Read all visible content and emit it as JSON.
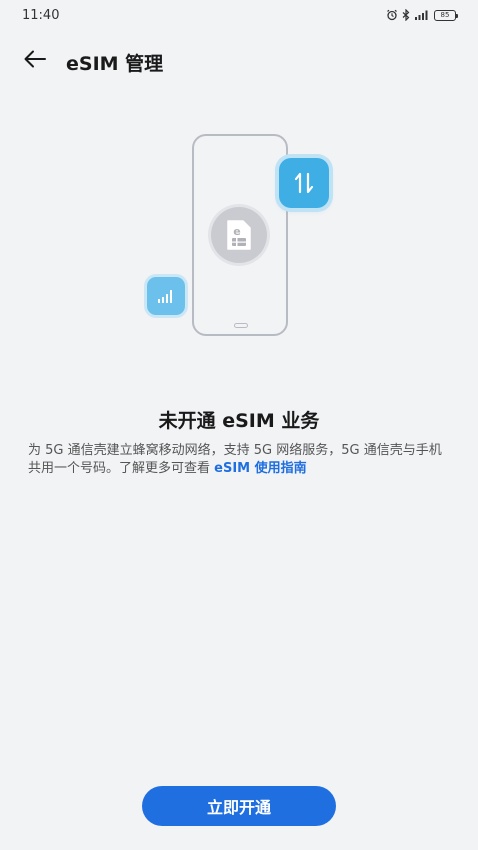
{
  "status_bar": {
    "time": "11:40",
    "battery_level": "85",
    "icons": [
      "alarm-icon",
      "bluetooth-icon",
      "signal-icon",
      "battery-icon"
    ]
  },
  "header": {
    "title": "eSIM 管理",
    "back_icon": "back-arrow-icon"
  },
  "illustration": {
    "sim_label": "e"
  },
  "content": {
    "headline": "未开通 eSIM 业务",
    "description": "为 5G 通信壳建立蜂窝移动网络，支持 5G 网络服务，5G 通信壳与手机共用一个号码。了解更多可查看 ",
    "guide_link": "eSIM 使用指南"
  },
  "actions": {
    "activate_label": "立即开通"
  },
  "colors": {
    "background": "#f1f3f5",
    "accent": "#1f6fe0",
    "bubble_blue": "#3eaee5"
  }
}
